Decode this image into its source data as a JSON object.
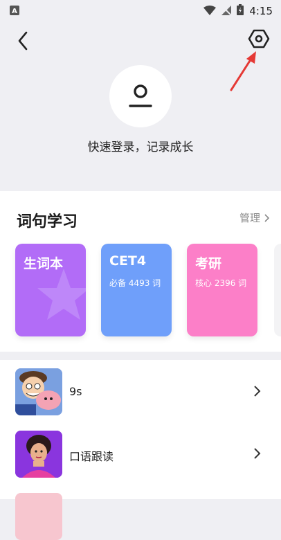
{
  "status_bar": {
    "time": "4:15"
  },
  "profile": {
    "login_prompt": "快速登录，记录成长"
  },
  "section": {
    "title": "词句学习",
    "manage_label": "管理",
    "books": [
      {
        "title": "生词本",
        "subtitle": "",
        "color": "#b26cf7"
      },
      {
        "title": "CET4",
        "subtitle": "必备 4493 词",
        "color": "#6f9ffa"
      },
      {
        "title": "考研",
        "subtitle": "核心 2396 词",
        "color": "#fc7fc8"
      }
    ]
  },
  "list": {
    "items": [
      {
        "label": "9s"
      },
      {
        "label": "口语跟读"
      }
    ]
  },
  "colors": {
    "accent_annotation": "#e53935",
    "background": "#efeff3"
  }
}
